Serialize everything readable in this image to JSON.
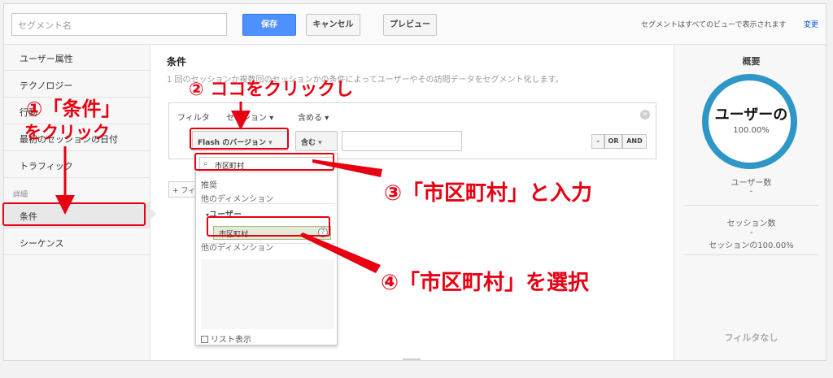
{
  "topbar": {
    "segment_name_placeholder": "セグメント名",
    "save_label": "保存",
    "cancel_label": "キャンセル",
    "preview_label": "プレビュー",
    "views_note": "セグメントはすべてのビューで表示されます",
    "change_link": "変更"
  },
  "sidebar": {
    "items": [
      {
        "label": "ユーザー属性"
      },
      {
        "label": "テクノロジー"
      },
      {
        "label": "行動"
      },
      {
        "label": "最初のセッションの日付"
      },
      {
        "label": "トラフィック"
      }
    ],
    "advanced_label": "詳細",
    "advanced_items": [
      {
        "label": "条件"
      },
      {
        "label": "シーケンス"
      }
    ]
  },
  "main": {
    "title": "条件",
    "description": "1 回のセッションか複数回のセッションかの条件によってユーザーやその訪問データをセグメント化します。",
    "filter": {
      "filter_label": "フィルタ",
      "scope_label": "セッション",
      "include_label": "含める",
      "dimension_dropdown": "Flash のバージョン",
      "match_dropdown": "含む",
      "minus_btn": "–",
      "or_btn": "OR",
      "and_btn": "AND"
    },
    "add_filter_label": "+ フィルタを追加"
  },
  "popup": {
    "search_value": "市区町村",
    "recommended": "推奨",
    "other_dims_1": "他のディメンション",
    "category": "ユーザー",
    "selected_item": "市区町村",
    "other_dims_2": "他のディメンション",
    "list_view": "リスト表示"
  },
  "summary": {
    "title": "概要",
    "ring_main": "ユーザーの",
    "ring_pct": "100.00%",
    "users_label": "ユーザー数",
    "users_value": "-",
    "sessions_label": "セッション数",
    "sessions_value": "-",
    "sessions_pct": "セッションの100.00%",
    "no_filter": "フィルタなし"
  },
  "annotations": {
    "step1_line1": "①「条件」",
    "step1_line2": "をクリック",
    "step2": "② ココをクリックし",
    "step3": "③「市区町村」と入力",
    "step4": "④「市区町村」を選択"
  },
  "colors": {
    "annotation_red": "#e60012",
    "primary_blue": "#4d90fe",
    "ring_blue": "#2f97c8"
  }
}
